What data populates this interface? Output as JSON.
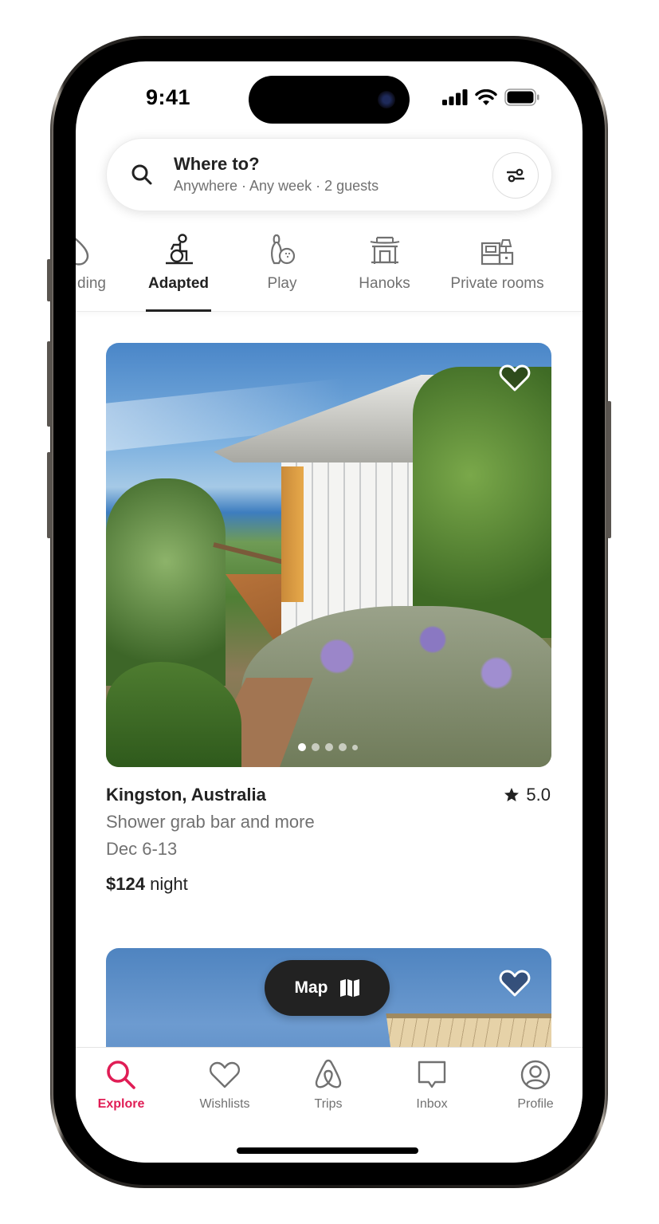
{
  "status_bar": {
    "time": "9:41"
  },
  "search": {
    "title": "Where to?",
    "subtitle": "Anywhere · Any week · 2 guests",
    "filter_icon": "sliders-icon"
  },
  "categories": [
    {
      "label": "ding",
      "icon": "drop-icon",
      "active": false
    },
    {
      "label": "Adapted",
      "icon": "wheelchair-icon",
      "active": true
    },
    {
      "label": "Play",
      "icon": "bowling-icon",
      "active": false
    },
    {
      "label": "Hanoks",
      "icon": "hanok-icon",
      "active": false
    },
    {
      "label": "Private rooms",
      "icon": "bed-lamp-icon",
      "active": false
    }
  ],
  "listing": {
    "location": "Kingston, Australia",
    "rating": "5.0",
    "description": "Shower grab bar and more",
    "dates": "Dec 6-13",
    "price": "$124",
    "price_unit": "night",
    "photo_count": 5,
    "current_photo": 1,
    "wishlisted": false
  },
  "map_button": {
    "label": "Map",
    "icon": "map-icon"
  },
  "bottom_nav": [
    {
      "label": "Explore",
      "icon": "search-icon",
      "active": true
    },
    {
      "label": "Wishlists",
      "icon": "heart-icon",
      "active": false
    },
    {
      "label": "Trips",
      "icon": "airbnb-logo-icon",
      "active": false
    },
    {
      "label": "Inbox",
      "icon": "message-icon",
      "active": false
    },
    {
      "label": "Profile",
      "icon": "user-circle-icon",
      "active": false
    }
  ],
  "colors": {
    "brand": "#e01d55",
    "text_primary": "#222222",
    "text_secondary": "#717171"
  }
}
